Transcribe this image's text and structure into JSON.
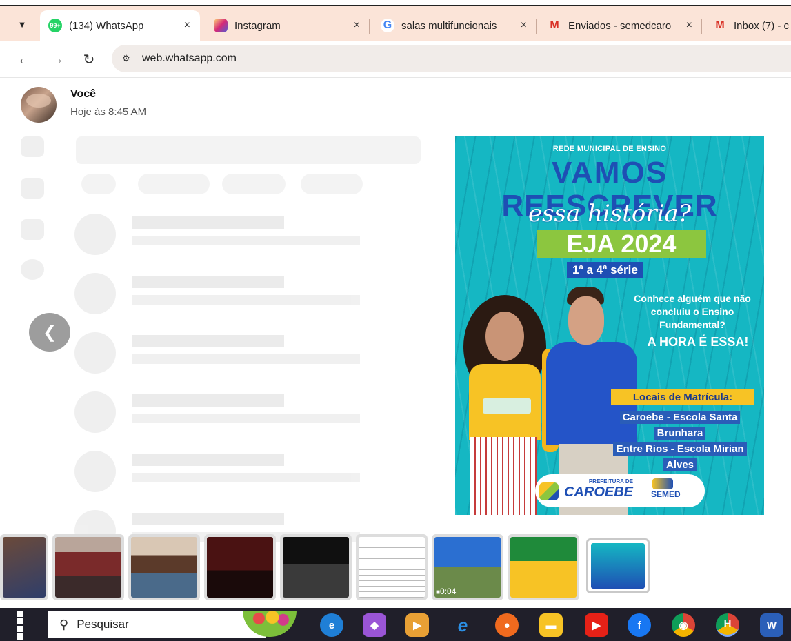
{
  "browser": {
    "tabs": [
      {
        "label": "(134) WhatsApp",
        "icon": "whatsapp-icon",
        "badge": "99+",
        "active": true
      },
      {
        "label": "Instagram",
        "icon": "instagram-icon",
        "active": false
      },
      {
        "label": "salas multifuncionais",
        "icon": "google-icon",
        "active": false
      },
      {
        "label": "Enviados - semedcaro",
        "icon": "gmail-icon",
        "active": false
      },
      {
        "label": "Inbox (7) - c",
        "icon": "gmail-icon",
        "active": false
      }
    ],
    "tab_close": "×",
    "tab_dropdown_icon": "chevron-down-icon",
    "url": "web.whatsapp.com",
    "back_icon": "back-arrow-icon",
    "forward_icon": "forward-arrow-icon",
    "reload_icon": "reload-icon",
    "site_info_icon": "site-settings-icon"
  },
  "viewer": {
    "sender_name": "Você",
    "timestamp": "Hoje às 8:45 AM",
    "prev_icon": "chevron-left-icon",
    "poster": {
      "network": "REDE MUNICIPAL DE ENSINO",
      "headline_1": "VAMOS",
      "headline_2": "REESCREVER",
      "script": "essa história?",
      "eja": "EJA 2024",
      "grades": "1ª a 4ª série",
      "question": "Conhece alguém que não concluiu o Ensino Fundamental?",
      "call": "A HORA É ESSA!",
      "locations_title": "Locais de Matrícula:",
      "locations": [
        "Caroebe - Escola Santa",
        "Brunhara",
        "Entre Rios - Escola Mirian",
        "Alves"
      ],
      "logo_pref": "PREFEITURA DE",
      "logo_city": "CAROEBE",
      "logo_semed": "SEMED"
    }
  },
  "thumbnails": [
    {
      "kind": "photo",
      "colors": [
        "#6b4a3a",
        "#2f3e6a"
      ],
      "selected": false
    },
    {
      "kind": "photo",
      "colors": [
        "#7a2a2a",
        "#3b2a2a"
      ],
      "selected": false
    },
    {
      "kind": "photo",
      "colors": [
        "#5b3a2a",
        "#4a6a8a"
      ],
      "selected": false
    },
    {
      "kind": "photo",
      "colors": [
        "#4a1212",
        "#1a0a0a"
      ],
      "selected": false
    },
    {
      "kind": "photo",
      "colors": [
        "#101010",
        "#3a3a3a"
      ],
      "selected": false
    },
    {
      "kind": "document",
      "colors": [
        "#ffffff",
        "#eeeeee"
      ],
      "selected": false
    },
    {
      "kind": "video",
      "colors": [
        "#2b6fd1",
        "#6b8a4a"
      ],
      "duration": "0:04",
      "selected": false
    },
    {
      "kind": "photo",
      "colors": [
        "#1f8a3a",
        "#f7c325"
      ],
      "selected": false
    },
    {
      "kind": "photo",
      "colors": [
        "#15b7c3",
        "#1e4fb4"
      ],
      "selected": true
    }
  ],
  "taskbar": {
    "search_placeholder": "Pesquisar",
    "start_icon": "windows-start-icon",
    "search_icon": "search-icon",
    "apps": [
      {
        "name": "edge-icon",
        "glyph": "e",
        "color": "#1f7fd6"
      },
      {
        "name": "copilot-icon",
        "glyph": "◆",
        "color": "#9a55d6"
      },
      {
        "name": "media-player-icon",
        "glyph": "▶",
        "color": "#e8a035"
      },
      {
        "name": "internet-explorer-icon",
        "glyph": "ℯ",
        "color": "#2b8ee3"
      },
      {
        "name": "firefox-icon",
        "glyph": "●",
        "color": "#f06a1e"
      },
      {
        "name": "file-explorer-icon",
        "glyph": "▬",
        "color": "#f7c325"
      },
      {
        "name": "youtube-icon",
        "glyph": "▶",
        "color": "#e62117"
      },
      {
        "name": "facebook-icon",
        "glyph": "f",
        "color": "#1877f2"
      },
      {
        "name": "chrome-icon",
        "glyph": "◉",
        "color": "#db4437"
      },
      {
        "name": "chrome-profile-icon",
        "glyph": "H",
        "color": "#0f9d58"
      },
      {
        "name": "word-icon",
        "glyph": "W",
        "color": "#2b5fb8"
      }
    ]
  }
}
